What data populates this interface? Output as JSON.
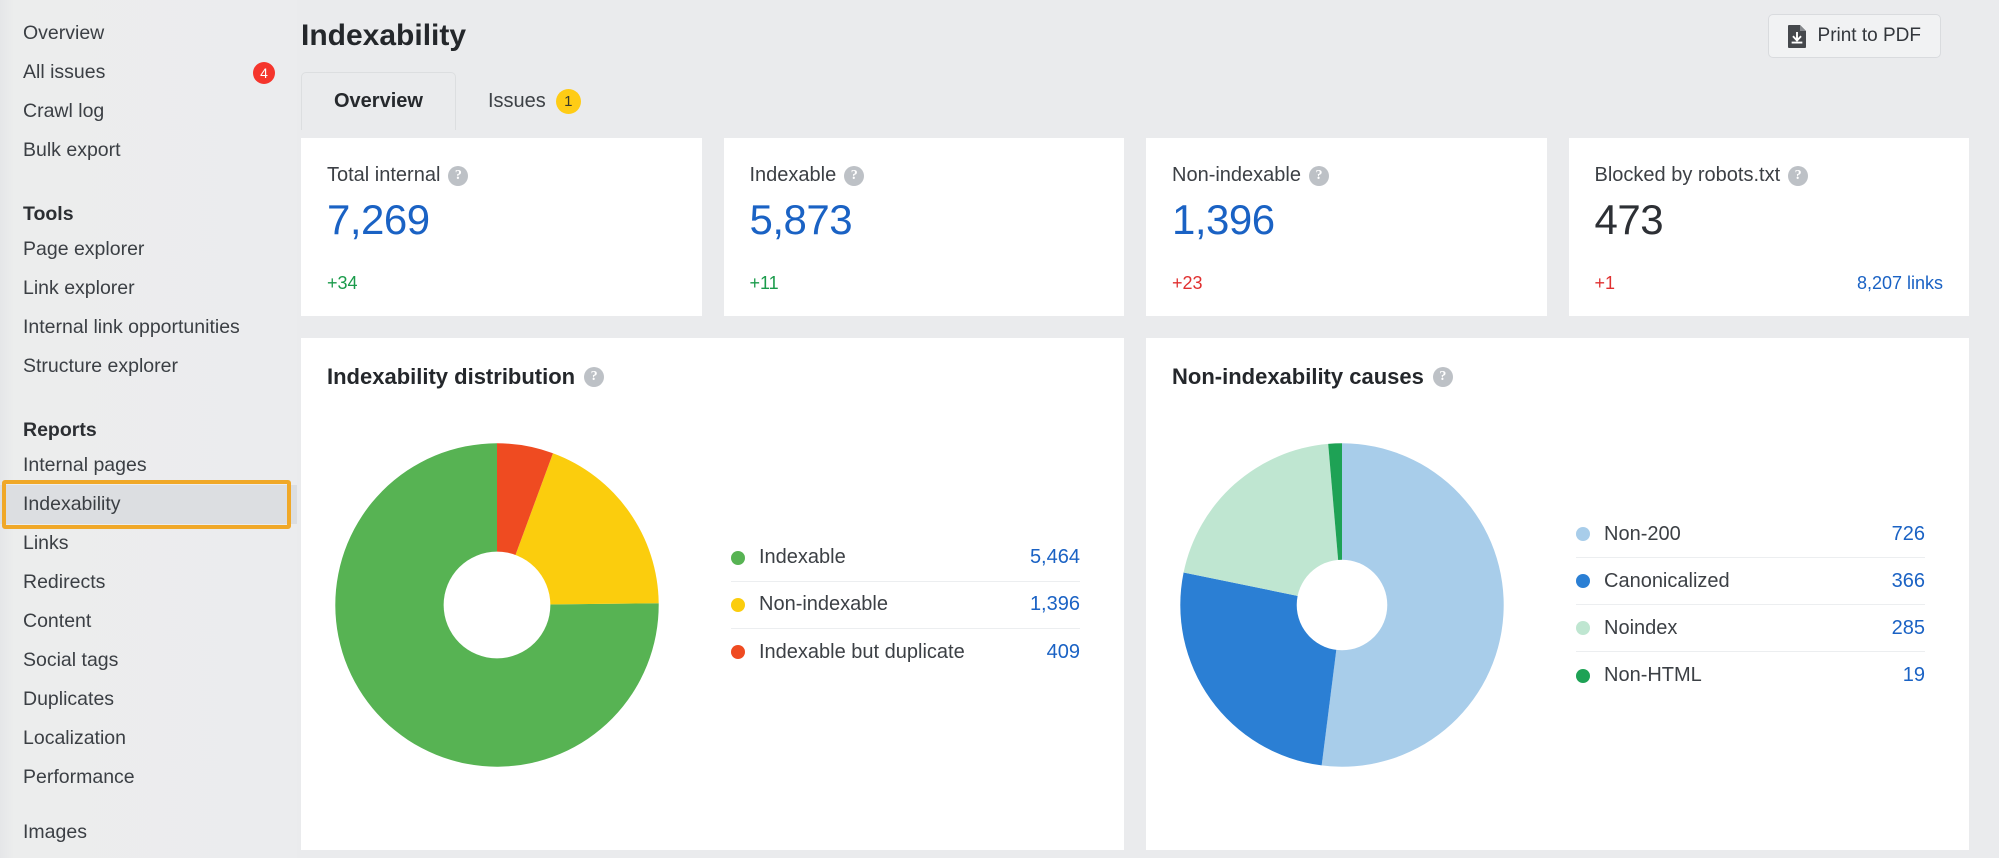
{
  "sidebar": {
    "items": [
      {
        "label": "Overview",
        "badge": null,
        "selected": false,
        "type": "item"
      },
      {
        "label": "All issues",
        "badge": "4",
        "badge_color": "#f5352c",
        "selected": false,
        "type": "item"
      },
      {
        "label": "Crawl log",
        "badge": null,
        "selected": false,
        "type": "item"
      },
      {
        "label": "Bulk export",
        "badge": null,
        "selected": false,
        "type": "item"
      },
      {
        "label": "Tools",
        "type": "group"
      },
      {
        "label": "Page explorer",
        "badge": null,
        "selected": false,
        "type": "item"
      },
      {
        "label": "Link explorer",
        "badge": null,
        "selected": false,
        "type": "item"
      },
      {
        "label": "Internal link opportunities",
        "badge": null,
        "selected": false,
        "type": "item"
      },
      {
        "label": "Structure explorer",
        "badge": null,
        "selected": false,
        "type": "item"
      },
      {
        "label": "Reports",
        "type": "group"
      },
      {
        "label": "Internal pages",
        "badge": null,
        "selected": false,
        "type": "item"
      },
      {
        "label": "Indexability",
        "badge": null,
        "selected": true,
        "type": "item"
      },
      {
        "label": "Links",
        "badge": null,
        "selected": false,
        "type": "item"
      },
      {
        "label": "Redirects",
        "badge": null,
        "selected": false,
        "type": "item"
      },
      {
        "label": "Content",
        "badge": null,
        "selected": false,
        "type": "item"
      },
      {
        "label": "Social tags",
        "badge": null,
        "selected": false,
        "type": "item"
      },
      {
        "label": "Duplicates",
        "badge": null,
        "selected": false,
        "type": "item"
      },
      {
        "label": "Localization",
        "badge": null,
        "selected": false,
        "type": "item"
      },
      {
        "label": "Performance",
        "badge": null,
        "selected": false,
        "type": "item"
      },
      {
        "label": "",
        "type": "spacer"
      },
      {
        "label": "Images",
        "badge": null,
        "selected": false,
        "type": "item"
      }
    ],
    "highlight_color": "#f0a828"
  },
  "header": {
    "title": "Indexability",
    "print_button": {
      "label": "Print to PDF",
      "icon": "pdf-download-icon"
    }
  },
  "tabs": [
    {
      "label": "Overview",
      "badge": null,
      "active": true
    },
    {
      "label": "Issues",
      "badge": "1",
      "badge_color": "#ffcc15",
      "active": false
    }
  ],
  "stats": [
    {
      "label": "Total internal",
      "value": "7,269",
      "value_color": "#1a62c4",
      "delta": "+34",
      "delta_dir": "up",
      "extra": ""
    },
    {
      "label": "Indexable",
      "value": "5,873",
      "value_color": "#1a62c4",
      "delta": "+11",
      "delta_dir": "up",
      "extra": ""
    },
    {
      "label": "Non-indexable",
      "value": "1,396",
      "value_color": "#1a62c4",
      "delta": "+23",
      "delta_dir": "down",
      "extra": ""
    },
    {
      "label": "Blocked by robots.txt",
      "value": "473",
      "value_color": "#2d3035",
      "delta": "+1",
      "delta_dir": "down",
      "extra": "8,207 links"
    }
  ],
  "chart_data": [
    {
      "type": "pie",
      "title": "Indexability distribution",
      "categories": [
        "Indexable",
        "Non-indexable",
        "Indexable but duplicate"
      ],
      "values": [
        5464,
        1396,
        409
      ],
      "value_labels": [
        "5,464",
        "1,396",
        "409"
      ],
      "colors": [
        "#57b353",
        "#fbcd0d",
        "#ef4b21"
      ],
      "total": 7269,
      "donut_hole_ratio": 0.33,
      "legend_position": "right",
      "start_angle_deg": 0,
      "direction": "counterclockwise"
    },
    {
      "type": "pie",
      "title": "Non-indexability causes",
      "categories": [
        "Non-200",
        "Canonicalized",
        "Noindex",
        "Non-HTML"
      ],
      "values": [
        726,
        366,
        285,
        19
      ],
      "value_labels": [
        "726",
        "366",
        "285",
        "19"
      ],
      "colors": [
        "#a8cdea",
        "#2b7fd4",
        "#bfe6d1",
        "#1ea255"
      ],
      "total": 1396,
      "donut_hole_ratio": 0.28,
      "legend_position": "right",
      "start_angle_deg": 0,
      "direction": "clockwise"
    }
  ]
}
